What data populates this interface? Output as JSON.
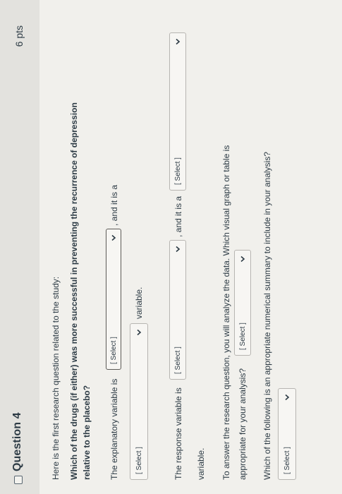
{
  "question": {
    "title": "Question 4",
    "points": "6 pts"
  },
  "body": {
    "intro": "Here is the first research question related to the study:",
    "research_question_line1": "Which of the drugs (if either) was more successful in preventing the recurrence of depression",
    "research_question_line2": "relative to the placebo?",
    "explanatory_prefix": "The explanatory variable is",
    "explanatory_suffix": ", and it is a",
    "explanatory_type_suffix": "variable.",
    "response_prefix": "The response variable is",
    "response_mid": ", and it is a",
    "response_end": "variable.",
    "analysis_line1": "To answer the research question, you will analyze the data. Which visual graph or table is",
    "analysis_line2": "appropriate for your analysis?",
    "summary_question": "Which of the following is an appropriate numerical summary to include in your analysis?"
  },
  "selects": {
    "explanatory_variable": "[ Select ]",
    "explanatory_type": "[ Select ]",
    "response_variable": "[ Select ]",
    "response_type": "[ Select ]",
    "graph_or_table": "[ Select ]",
    "numerical_summary": "[ Select ]"
  },
  "icons": {
    "checkbox": "checkbox-icon",
    "dropdown": "chevron-down-icon"
  }
}
